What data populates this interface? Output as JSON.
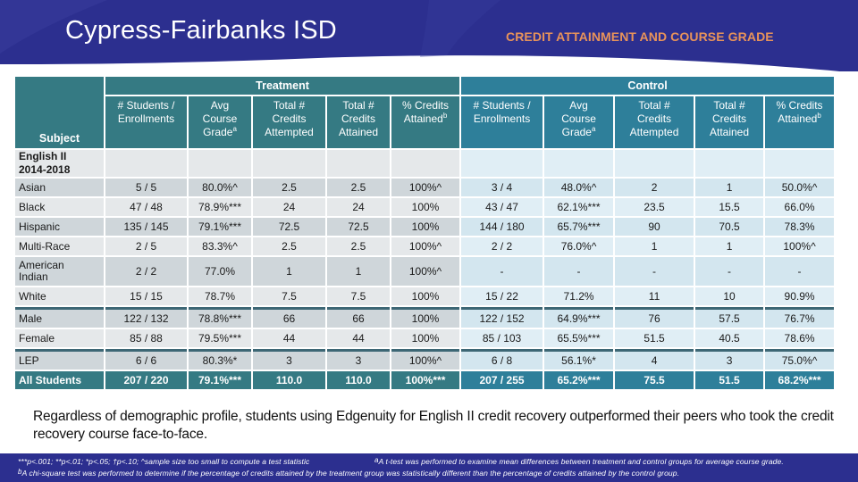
{
  "header": {
    "title": "Cypress-Fairbanks ISD",
    "subtitle": "CREDIT ATTAINMENT AND COURSE GRADE"
  },
  "colors": {
    "banner": "#2c2f8f",
    "subtitle": "#e8935a",
    "treatment_header": "#357a83",
    "control_header": "#2e7f9a"
  },
  "table": {
    "groups": {
      "treatment": "Treatment",
      "control": "Control"
    },
    "subject_header": "Subject",
    "columns": [
      "# Students / Enrollments",
      "Avg Course Grade",
      "Total # Credits Attempted",
      "Total # Credits Attained",
      "% Credits Attained"
    ],
    "column_lines": [
      [
        "# Students /",
        "Enrollments",
        ""
      ],
      [
        "Avg",
        "Course",
        "Grade"
      ],
      [
        "Total #",
        "Credits",
        "Attempted"
      ],
      [
        "Total #",
        "Credits",
        "Attained"
      ],
      [
        "% Credits",
        "Attained",
        ""
      ]
    ],
    "column_superscripts": [
      "",
      "a",
      "",
      "",
      "b"
    ],
    "section": {
      "line1": "English II",
      "line2": "2014-2018"
    },
    "rows": [
      {
        "subject": "Asian",
        "treatment": [
          "5 / 5",
          "80.0%^",
          "2.5",
          "2.5",
          "100%^"
        ],
        "control": [
          "3 / 4",
          "48.0%^",
          "2",
          "1",
          "50.0%^"
        ]
      },
      {
        "subject": "Black",
        "treatment": [
          "47 / 48",
          "78.9%***",
          "24",
          "24",
          "100%"
        ],
        "control": [
          "43 / 47",
          "62.1%***",
          "23.5",
          "15.5",
          "66.0%"
        ]
      },
      {
        "subject": "Hispanic",
        "treatment": [
          "135 / 145",
          "79.1%***",
          "72.5",
          "72.5",
          "100%"
        ],
        "control": [
          "144 / 180",
          "65.7%***",
          "90",
          "70.5",
          "78.3%"
        ]
      },
      {
        "subject": "Multi-Race",
        "treatment": [
          "2 / 5",
          "83.3%^",
          "2.5",
          "2.5",
          "100%^"
        ],
        "control": [
          "2 / 2",
          "76.0%^",
          "1",
          "1",
          "100%^"
        ]
      },
      {
        "subject": "American Indian",
        "subject_line1": "American",
        "subject_line2": "Indian",
        "treatment": [
          "2 / 2",
          "77.0%",
          "1",
          "1",
          "100%^"
        ],
        "control": [
          "-",
          "-",
          "-",
          "-",
          "-"
        ]
      },
      {
        "subject": "White",
        "treatment": [
          "15 / 15",
          "78.7%",
          "7.5",
          "7.5",
          "100%"
        ],
        "control": [
          "15 / 22",
          "71.2%",
          "11",
          "10",
          "90.9%"
        ]
      },
      {
        "subject": "Male",
        "treatment": [
          "122 / 132",
          "78.8%***",
          "66",
          "66",
          "100%"
        ],
        "control": [
          "122 / 152",
          "64.9%***",
          "76",
          "57.5",
          "76.7%"
        ]
      },
      {
        "subject": "Female",
        "treatment": [
          "85 / 88",
          "79.5%***",
          "44",
          "44",
          "100%"
        ],
        "control": [
          "85 / 103",
          "65.5%***",
          "51.5",
          "40.5",
          "78.6%"
        ]
      },
      {
        "subject": "LEP",
        "treatment": [
          "6 / 6",
          "80.3%*",
          "3",
          "3",
          "100%^"
        ],
        "control": [
          "6 / 8",
          "56.1%*",
          "4",
          "3",
          "75.0%^"
        ]
      }
    ],
    "total": {
      "subject": "All Students",
      "treatment": [
        "207 / 220",
        "79.1%***",
        "110.0",
        "110.0",
        "100%***"
      ],
      "control": [
        "207 / 255",
        "65.2%***",
        "75.5",
        "51.5",
        "68.2%***"
      ]
    }
  },
  "summary": "Regardless of demographic profile, students using Edgenuity for English II credit recovery outperformed their peers who took the credit recovery course face-to-face.",
  "footnotes": {
    "significance": "***p<.001; **p<.01; *p<.05; †p<.10; ^sample size too small to compute a test statistic",
    "a": "A t-test was performed to examine mean differences between treatment and control groups for average course grade.",
    "a_marker": "a",
    "b": "A chi-square test was performed to determine if the percentage of credits attained by the treatment group was statistically different than the percentage of credits attained by the control group.",
    "b_marker": "b"
  }
}
